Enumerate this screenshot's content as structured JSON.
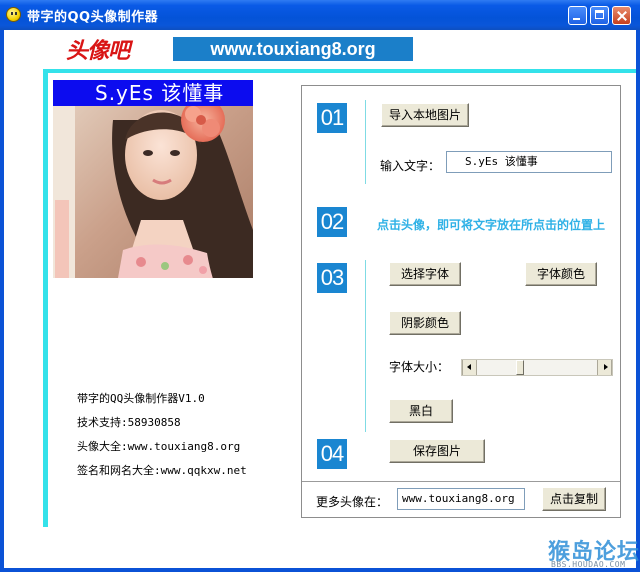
{
  "window": {
    "title": "带字的QQ头像制作器"
  },
  "header": {
    "logo_text": "头像吧",
    "url_banner": "www.touxiang8.org"
  },
  "avatar": {
    "caption": "S.yEs 该懂事"
  },
  "info": {
    "lines": [
      "带字的QQ头像制作器V1.0",
      "技术支持:58930858",
      "头像大全:www.touxiang8.org",
      "签名和网名大全:www.qqkxw.net"
    ]
  },
  "steps": {
    "s1": {
      "number": "01",
      "import_button": "导入本地图片",
      "input_label": "输入文字：",
      "input_value": "S.yEs 该懂事"
    },
    "s2": {
      "number": "02",
      "hint": "点击头像，即可将文字放在所点击的位置上"
    },
    "s3": {
      "number": "03",
      "font_button": "选择字体",
      "color_button": "字体颜色",
      "shadow_button": "阴影颜色",
      "size_label": "字体大小：",
      "bw_button": "黑白",
      "font_size_fraction": 0.35
    },
    "s4": {
      "number": "04",
      "save_button": "保存图片"
    }
  },
  "more": {
    "label": "更多头像在：",
    "url_value": "www.touxiang8.org",
    "copy_button": "点击复制"
  },
  "watermark": {
    "main": "猴岛论坛",
    "sub": "BBS.HOUDAO.COM"
  },
  "colors": {
    "titlebar": "#0453d8",
    "accent_cyan": "#34e2ea",
    "step_blue": "#1a86d1",
    "hint_blue": "#2fb1e6",
    "caption_bg": "#0c0cef"
  }
}
